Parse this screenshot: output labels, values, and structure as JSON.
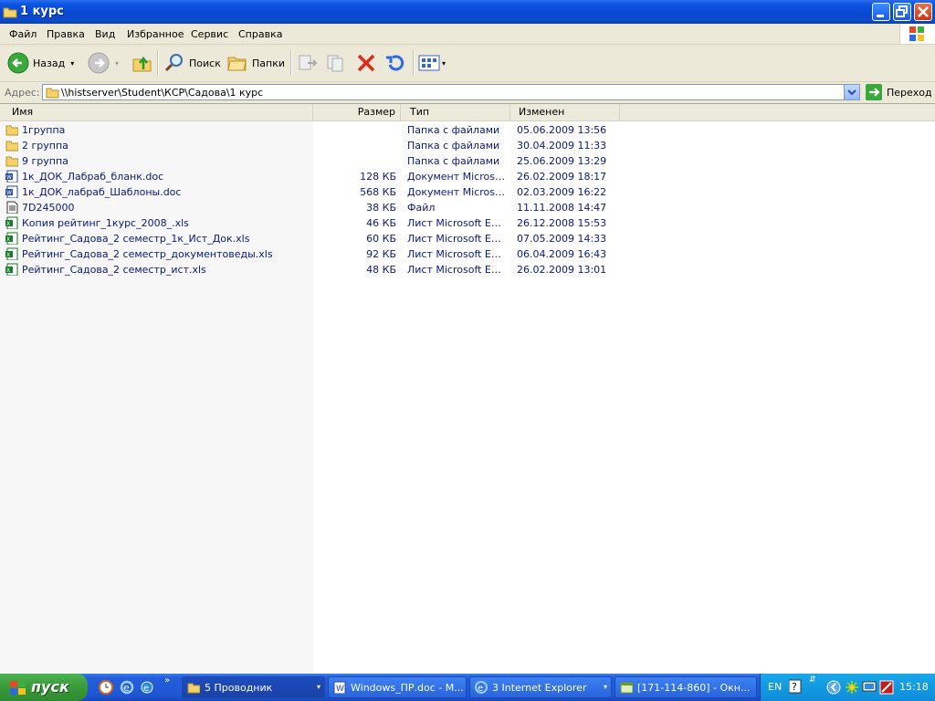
{
  "window": {
    "title": "1 курс"
  },
  "menu": {
    "items": [
      "Файл",
      "Правка",
      "Вид",
      "Избранное",
      "Сервис",
      "Справка"
    ]
  },
  "toolbar": {
    "back_label": "Назад",
    "search_label": "Поиск",
    "folders_label": "Папки"
  },
  "address": {
    "label": "Адрес:",
    "value": "\\\\histserver\\Student\\КСР\\Садова\\1 курс",
    "go_label": "Переход"
  },
  "list": {
    "columns": {
      "name": "Имя",
      "size": "Размер",
      "type": "Тип",
      "modified": "Изменен"
    },
    "rows": [
      {
        "icon": "folder-icon",
        "name": "1группа",
        "size": "",
        "type": "Папка с файлами",
        "modified": "05.06.2009 13:56"
      },
      {
        "icon": "folder-icon",
        "name": "2 группа",
        "size": "",
        "type": "Папка с файлами",
        "modified": "30.04.2009 11:33"
      },
      {
        "icon": "folder-icon",
        "name": "9 группа",
        "size": "",
        "type": "Папка с файлами",
        "modified": "25.06.2009 13:29"
      },
      {
        "icon": "word-doc-icon",
        "name": "1к_ДОК_Лабраб_бланк.doc",
        "size": "128 КБ",
        "type": "Документ Microsof...",
        "modified": "26.02.2009 18:17"
      },
      {
        "icon": "word-doc-icon",
        "name": "1к_ДОК_лабраб_Шаблоны.doc",
        "size": "568 КБ",
        "type": "Документ Microsof...",
        "modified": "02.03.2009 16:22"
      },
      {
        "icon": "file-icon",
        "name": "7D245000",
        "size": "38 КБ",
        "type": "Файл",
        "modified": "11.11.2008 14:47"
      },
      {
        "icon": "excel-icon",
        "name": "Копия рейтинг_1курс_2008_.xls",
        "size": "46 КБ",
        "type": "Лист Microsoft Excel",
        "modified": "26.12.2008 15:53"
      },
      {
        "icon": "excel-icon",
        "name": "Рейтинг_Садова_2 семестр_1к_Ист_Док.xls",
        "size": "60 КБ",
        "type": "Лист Microsoft Excel",
        "modified": "07.05.2009 14:33"
      },
      {
        "icon": "excel-icon",
        "name": "Рейтинг_Садова_2 семестр_документоведы.xls",
        "size": "92 КБ",
        "type": "Лист Microsoft Excel",
        "modified": "06.04.2009 16:43"
      },
      {
        "icon": "excel-icon",
        "name": "Рейтинг_Садова_2 семестр_ист.xls",
        "size": "48 КБ",
        "type": "Лист Microsoft Excel",
        "modified": "26.02.2009 13:01"
      }
    ]
  },
  "taskbar": {
    "start_label": "пуск",
    "tasks": [
      {
        "label": "5 Проводник",
        "active": true
      },
      {
        "label": "Windows_ПР.doc - M...",
        "active": false
      },
      {
        "label": "3 Internet Explorer",
        "active": false
      },
      {
        "label": "[171-114-860] - Окн...",
        "active": false
      }
    ],
    "language": "EN",
    "clock": "15:18"
  },
  "colors": {
    "title_bar": "#0a55e0",
    "list_text": "#0a1a7a",
    "taskbar": "#245edb",
    "start_button": "#3c9e3c"
  }
}
